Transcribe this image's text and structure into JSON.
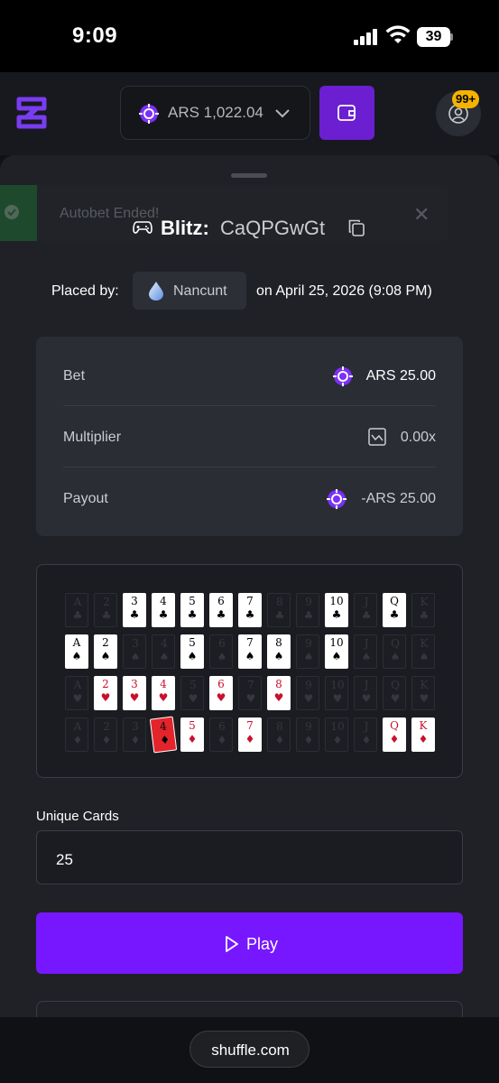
{
  "status_bar": {
    "time": "9:09",
    "battery": "39"
  },
  "header": {
    "balance": "ARS 1,022.04",
    "notifications_badge": "99+"
  },
  "toast": {
    "message": "Autobet Ended!"
  },
  "bet": {
    "game": "Blitz:",
    "bet_id": "CaQPGwGt",
    "placed_by_label": "Placed by:",
    "username": "Nancunt",
    "date": "on April 25, 2026 (9:08 PM)"
  },
  "stats": [
    {
      "label": "Bet",
      "value": "ARS 25.00",
      "icon": "chip-icon"
    },
    {
      "label": "Multiplier",
      "value": "0.00x",
      "icon": "multiplier-icon"
    },
    {
      "label": "Payout",
      "value": "-ARS 25.00",
      "icon": "chip-icon"
    }
  ],
  "cards": {
    "ranks": [
      "A",
      "2",
      "3",
      "4",
      "5",
      "6",
      "7",
      "8",
      "9",
      "10",
      "J",
      "Q",
      "K"
    ],
    "rows": [
      {
        "suit": "♣",
        "color": "black",
        "active": [
          "3",
          "4",
          "5",
          "6",
          "7",
          "10",
          "Q"
        ]
      },
      {
        "suit": "♠",
        "color": "black",
        "active": [
          "A",
          "2",
          "5",
          "7",
          "8",
          "10"
        ]
      },
      {
        "suit": "♥",
        "color": "red",
        "active": [
          "2",
          "3",
          "4",
          "6",
          "8"
        ]
      },
      {
        "suit": "♦",
        "color": "red",
        "active": [
          "5",
          "7",
          "Q",
          "K"
        ],
        "highlight": "4"
      }
    ]
  },
  "unique_cards": {
    "label": "Unique Cards",
    "value": "25"
  },
  "play_button": {
    "label": "Play"
  },
  "footer": {
    "domain": "shuffle.com"
  },
  "colors": {
    "accent": "#7717ff",
    "wallet": "#6b1fd1",
    "badge": "#f5b300",
    "suit_red": "#c8102e"
  }
}
